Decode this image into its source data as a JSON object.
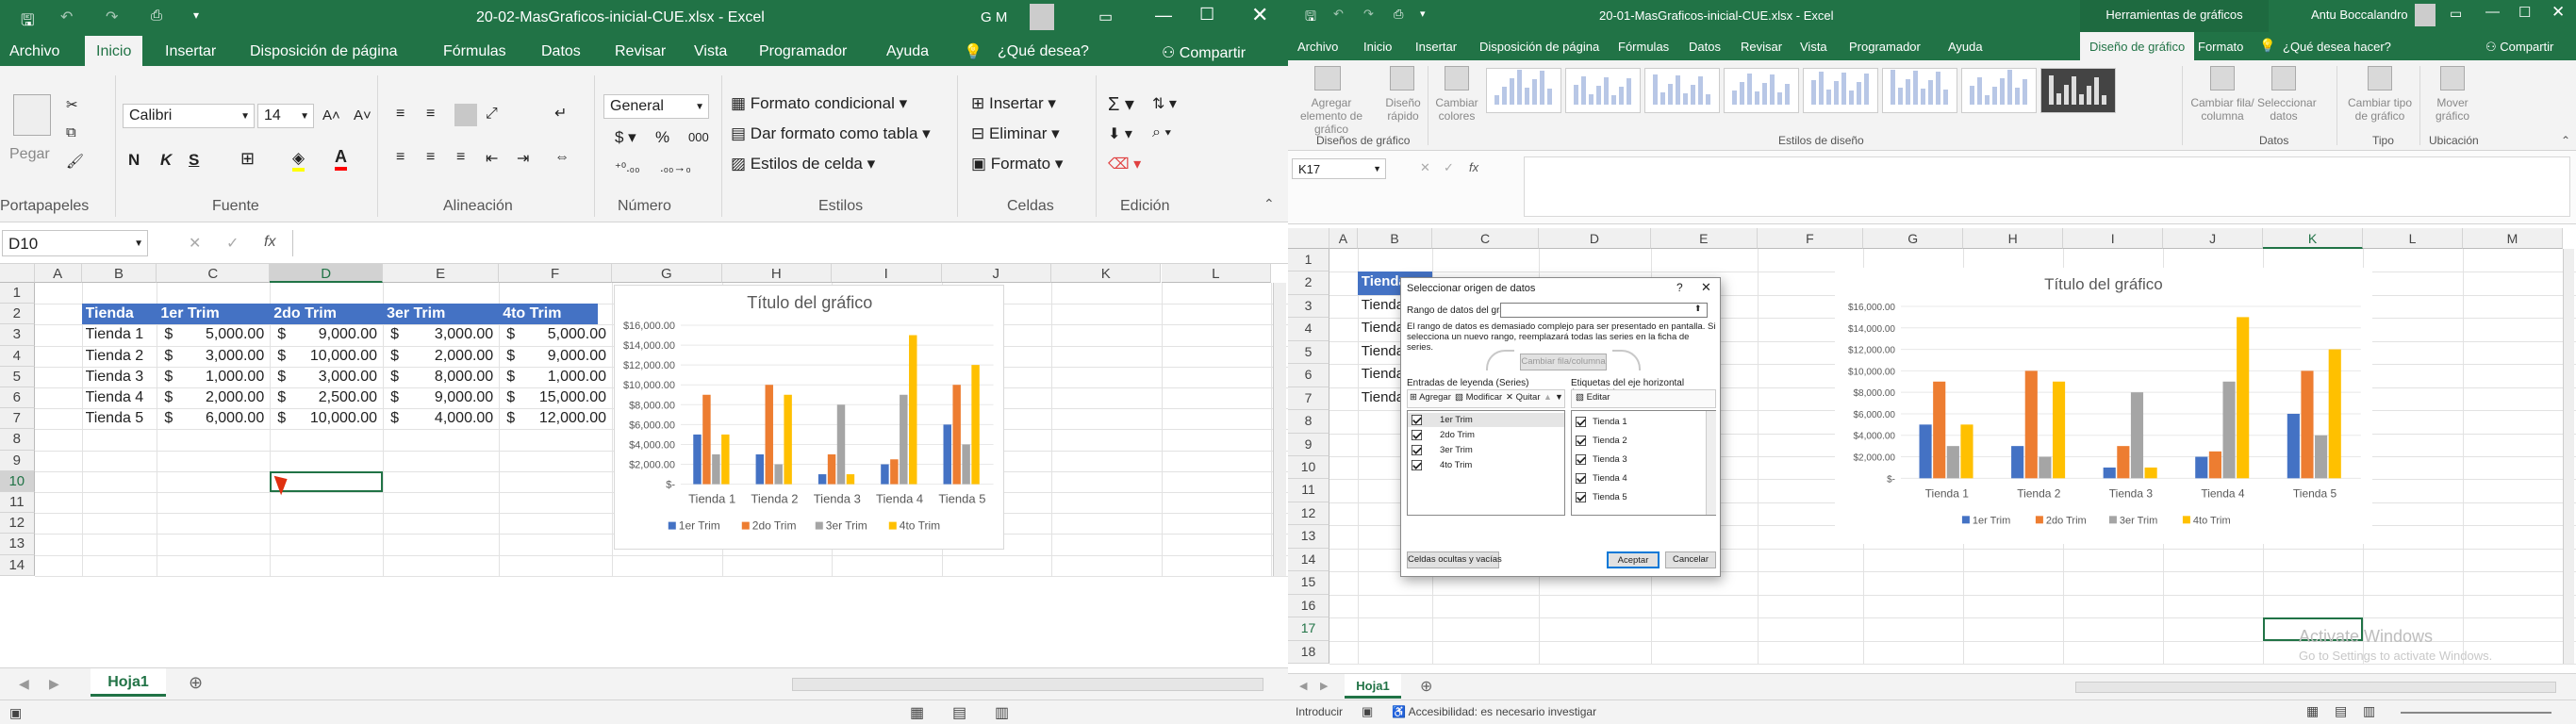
{
  "left": {
    "title": "20-02-MasGraficos-inicial-CUE.xlsx  -  Excel",
    "user": "G M",
    "tabs": [
      "Archivo",
      "Inicio",
      "Insertar",
      "Disposición de página",
      "Fórmulas",
      "Datos",
      "Revisar",
      "Vista",
      "Programador",
      "Ayuda"
    ],
    "tell_me": "¿Qué desea?",
    "share": "Compartir",
    "ribbon": {
      "paste": "Pegar",
      "font": "Calibri",
      "size": "14",
      "bold": "N",
      "italic": "K",
      "underline": "S",
      "numfmt": "General",
      "cond_format": "Formato condicional",
      "table_format": "Dar formato como tabla",
      "cell_styles": "Estilos de celda",
      "insert": "Insertar",
      "delete": "Eliminar",
      "format": "Formato",
      "groups": [
        "Portapapeles",
        "Fuente",
        "Alineación",
        "Número",
        "Estilos",
        "Celdas",
        "Edición"
      ]
    },
    "namebox": "D10",
    "cols": [
      "A",
      "B",
      "C",
      "D",
      "E",
      "F",
      "G",
      "H",
      "I",
      "J",
      "K",
      "L"
    ],
    "rows": [
      "1",
      "2",
      "3",
      "4",
      "5",
      "6",
      "7",
      "8",
      "9",
      "10",
      "11",
      "12",
      "13",
      "14"
    ],
    "table": {
      "headers": [
        "Tienda",
        "1er Trim",
        "2do Trim",
        "3er Trim",
        "4to Trim"
      ],
      "rows": [
        [
          "Tienda 1",
          "$",
          "5,000.00",
          "$",
          "9,000.00",
          "$",
          "3,000.00",
          "$",
          "5,000.00"
        ],
        [
          "Tienda 2",
          "$",
          "3,000.00",
          "$",
          "10,000.00",
          "$",
          "2,000.00",
          "$",
          "9,000.00"
        ],
        [
          "Tienda 3",
          "$",
          "1,000.00",
          "$",
          "3,000.00",
          "$",
          "8,000.00",
          "$",
          "1,000.00"
        ],
        [
          "Tienda 4",
          "$",
          "2,000.00",
          "$",
          "2,500.00",
          "$",
          "9,000.00",
          "$",
          "15,000.00"
        ],
        [
          "Tienda 5",
          "$",
          "6,000.00",
          "$",
          "10,000.00",
          "$",
          "4,000.00",
          "$",
          "12,000.00"
        ]
      ]
    },
    "sheet": "Hoja1"
  },
  "right": {
    "title": "20-01-MasGraficos-inicial-CUE.xlsx  -  Excel",
    "tools": "Herramientas de gráficos",
    "user": "Antu Boccalandro",
    "tabs": [
      "Archivo",
      "Inicio",
      "Insertar",
      "Disposición de página",
      "Fórmulas",
      "Datos",
      "Revisar",
      "Vista",
      "Programador",
      "Ayuda",
      "Diseño de gráfico",
      "Formato"
    ],
    "tell_me": "¿Qué desea hacer?",
    "share": "Compartir",
    "ribbon": {
      "add_element": "Agregar elemento de gráfico",
      "quick_layout": "Diseño rápido",
      "change_colors": "Cambiar colores",
      "switch": "Cambiar fila/ columna",
      "select_data": "Seleccionar datos",
      "change_type": "Cambiar tipo de gráfico",
      "move": "Mover gráfico",
      "groups": [
        "Diseños de gráfico",
        "Estilos de diseño",
        "Datos",
        "Tipo",
        "Ubicación"
      ]
    },
    "namebox": "K17",
    "cols": [
      "A",
      "B",
      "C",
      "D",
      "E",
      "F",
      "G",
      "H",
      "I",
      "J",
      "K",
      "L",
      "M"
    ],
    "rows": [
      "1",
      "2",
      "3",
      "4",
      "5",
      "6",
      "7",
      "8",
      "9",
      "10",
      "11",
      "12",
      "13",
      "14",
      "15",
      "16",
      "17",
      "18"
    ],
    "cells": [
      "Tienda",
      "Tienda 1",
      "Tienda 2",
      "Tienda 3",
      "Tienda 4",
      "Tienda 5"
    ],
    "sheet": "Hoja1",
    "status": "Introducir",
    "accessibility": "Accesibilidad: es necesario investigar",
    "watermark1": "Activate Windows",
    "watermark2": "Go to Settings to activate Windows.",
    "dialog": {
      "title": "Seleccionar origen de datos",
      "range_label": "Rango de datos del gráfico:",
      "warning": "El rango de datos es demasiado complejo para ser presentado en pantalla. Si selecciona un nuevo rango, reemplazará todas las series en la ficha de series.",
      "switch": "Cambiar fila/columna",
      "legend_label": "Entradas de leyenda (Series)",
      "axis_label": "Etiquetas del eje horizontal (categoría)",
      "add": "Agregar",
      "edit": "Modificar",
      "remove": "Quitar",
      "edit2": "Editar",
      "series": [
        "1er Trim",
        "2do Trim",
        "3er Trim",
        "4to Trim"
      ],
      "categories": [
        "Tienda 1",
        "Tienda 2",
        "Tienda 3",
        "Tienda 4",
        "Tienda 5"
      ],
      "hidden": "Celdas ocultas y vacías",
      "ok": "Aceptar",
      "cancel": "Cancelar"
    }
  },
  "colors": {
    "excel_green": "#217346",
    "header_blue": "#4472c4",
    "s1": "#4472c4",
    "s2": "#ed7d31",
    "s3": "#a5a5a5",
    "s4": "#ffc000"
  },
  "chart_data": [
    {
      "type": "bar",
      "title": "Título del gráfico",
      "categories": [
        "Tienda 1",
        "Tienda 2",
        "Tienda 3",
        "Tienda 4",
        "Tienda 5"
      ],
      "series": [
        {
          "name": "1er Trim",
          "values": [
            5000,
            3000,
            1000,
            2000,
            6000
          ]
        },
        {
          "name": "2do Trim",
          "values": [
            9000,
            10000,
            3000,
            2500,
            10000
          ]
        },
        {
          "name": "3er Trim",
          "values": [
            3000,
            2000,
            8000,
            9000,
            4000
          ]
        },
        {
          "name": "4to Trim",
          "values": [
            5000,
            9000,
            1000,
            15000,
            12000
          ]
        }
      ],
      "yticks": [
        "$-",
        "$2,000.00",
        "$4,000.00",
        "$6,000.00",
        "$8,000.00",
        "$10,000.00",
        "$12,000.00",
        "$14,000.00",
        "$16,000.00"
      ],
      "ylim": [
        0,
        16000
      ],
      "legend": "bottom"
    },
    {
      "type": "bar",
      "title": "Título del gráfico",
      "categories": [
        "Tienda 1",
        "Tienda 2",
        "Tienda 3",
        "Tienda 4",
        "Tienda 5"
      ],
      "series": [
        {
          "name": "1er Trim",
          "values": [
            5000,
            3000,
            1000,
            2000,
            6000
          ]
        },
        {
          "name": "2do Trim",
          "values": [
            9000,
            10000,
            3000,
            2500,
            10000
          ]
        },
        {
          "name": "3er Trim",
          "values": [
            3000,
            2000,
            8000,
            9000,
            4000
          ]
        },
        {
          "name": "4to Trim",
          "values": [
            5000,
            9000,
            1000,
            15000,
            12000
          ]
        }
      ],
      "yticks": [
        "$-",
        "$2,000.00",
        "$4,000.00",
        "$6,000.00",
        "$8,000.00",
        "$10,000.00",
        "$12,000.00",
        "$14,000.00",
        "$16,000.00"
      ],
      "ylim": [
        0,
        16000
      ],
      "legend": "bottom"
    }
  ]
}
